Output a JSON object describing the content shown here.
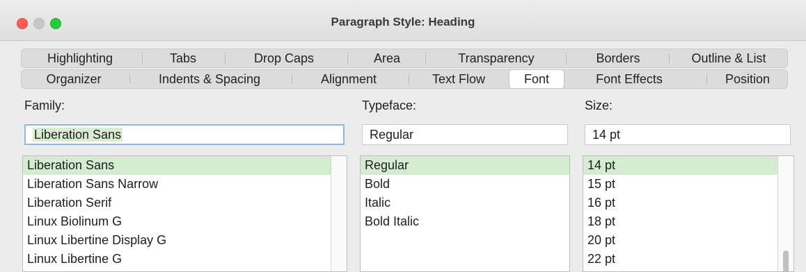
{
  "window": {
    "title": "Paragraph Style: Heading"
  },
  "tabs": {
    "row1": [
      "Highlighting",
      "Tabs",
      "Drop Caps",
      "Area",
      "Transparency",
      "Borders",
      "Outline & List"
    ],
    "row2": [
      "Organizer",
      "Indents & Spacing",
      "Alignment",
      "Text Flow",
      "Font",
      "Font Effects",
      "Position"
    ],
    "active": "Font"
  },
  "font": {
    "family_label": "Family:",
    "typeface_label": "Typeface:",
    "size_label": "Size:",
    "family_value": "Liberation Sans",
    "typeface_value": "Regular",
    "size_value": "14 pt",
    "family_list": [
      "Liberation Sans",
      "Liberation Sans Narrow",
      "Liberation Serif",
      "Linux Biolinum G",
      "Linux Libertine Display G",
      "Linux Libertine G"
    ],
    "typeface_list": [
      "Regular",
      "Bold",
      "Italic",
      "Bold Italic"
    ],
    "size_list": [
      "14 pt",
      "15 pt",
      "16 pt",
      "18 pt",
      "20 pt",
      "22 pt"
    ]
  },
  "colors": {
    "selection": "#d4ecd0",
    "focus_border": "#8fb6e6"
  }
}
